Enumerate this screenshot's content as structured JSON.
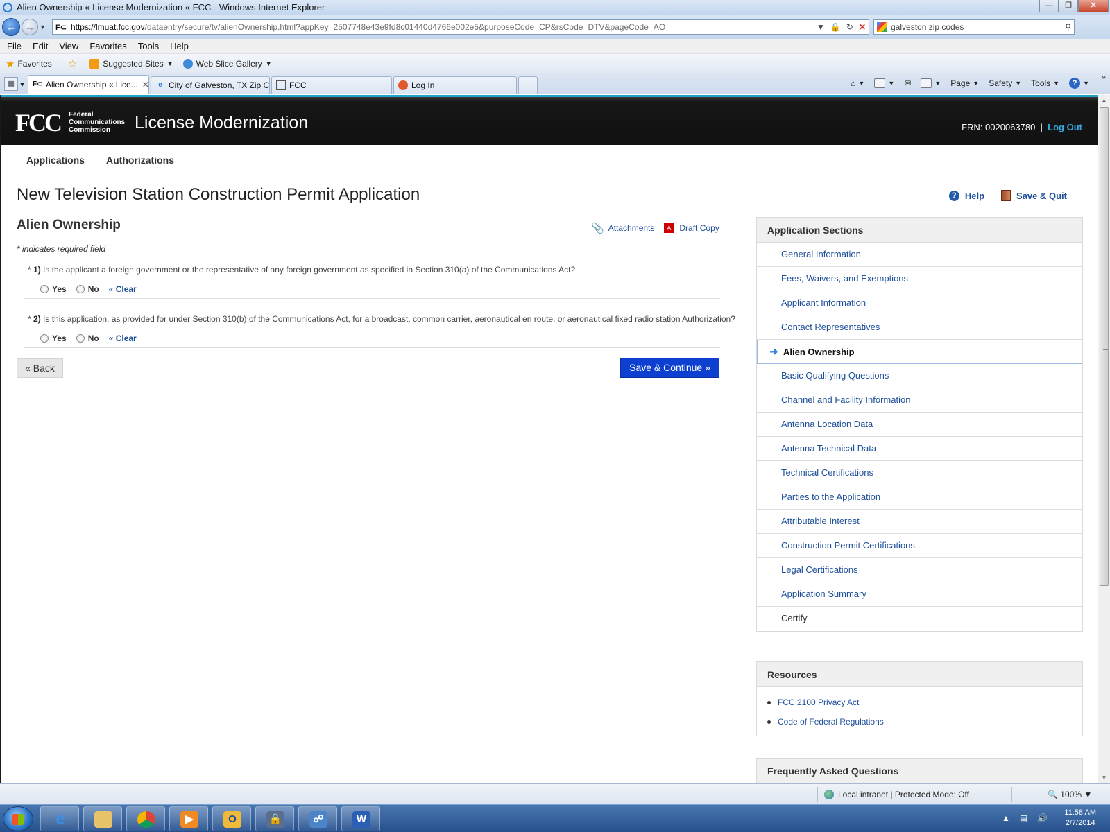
{
  "browser": {
    "window_title": "Alien Ownership « License Modernization « FCC - Windows Internet Explorer",
    "url_host": "https://lmuat.fcc.gov",
    "url_path": "/dataentry/secure/tv/alienOwnership.html?appKey=2507748e43e9fd8c01440d4766e002e5&purposeCode=CP&rsCode=DTV&pageCode=AO",
    "search_text": "galveston zip codes",
    "menu": [
      "File",
      "Edit",
      "View",
      "Favorites",
      "Tools",
      "Help"
    ],
    "favorites_label": "Favorites",
    "suggested_sites": "Suggested Sites",
    "web_slice_gallery": "Web Slice Gallery",
    "tabs": [
      {
        "label": "Alien Ownership « Lice...",
        "active": true
      },
      {
        "label": "City of Galveston, TX Zip C...",
        "active": false
      },
      {
        "label": "FCC",
        "active": false
      },
      {
        "label": "Log In",
        "active": false
      }
    ],
    "commands": {
      "page": "Page",
      "safety": "Safety",
      "tools": "Tools"
    },
    "status_zone": "Local intranet | Protected Mode: Off",
    "zoom": "100%"
  },
  "header": {
    "logo_mark": "FCC",
    "agency_line1": "Federal",
    "agency_line2": "Communications",
    "agency_line3": "Commission",
    "app_title": "License Modernization",
    "frn": "FRN: 0020063780",
    "separator": "|",
    "logout": "Log Out"
  },
  "topnav": {
    "applications": "Applications",
    "authorizations": "Authorizations"
  },
  "page": {
    "title": "New Television Station Construction Permit Application",
    "help": "Help",
    "save_quit": "Save & Quit",
    "section_title": "Alien Ownership",
    "attachments": "Attachments",
    "draft_copy": "Draft Copy",
    "required_note": "* indicates required field"
  },
  "questions": [
    {
      "prefix": "* ",
      "number": "1)",
      "text": " Is the applicant a foreign government or the representative of any foreign government as specified in Section 310(a) of the Communications Act?",
      "yes": "Yes",
      "no": "No",
      "clear": "« Clear"
    },
    {
      "prefix": "* ",
      "number": "2)",
      "text": " Is this application, as provided for under Section 310(b) of the Communications Act, for a broadcast, common carrier, aeronautical en route, or aeronautical fixed radio station Authorization?",
      "yes": "Yes",
      "no": "No",
      "clear": "« Clear"
    }
  ],
  "buttons": {
    "back": "« Back",
    "save_continue": "Save & Continue »"
  },
  "sidebar": {
    "sections_title": "Application Sections",
    "sections": [
      "General Information",
      "Fees, Waivers, and Exemptions",
      "Applicant Information",
      "Contact Representatives",
      "Alien Ownership",
      "Basic Qualifying Questions",
      "Channel and Facility Information",
      "Antenna Location Data",
      "Antenna Technical Data",
      "Technical Certifications",
      "Parties to the Application",
      "Attributable Interest",
      "Construction Permit Certifications",
      "Legal Certifications",
      "Application Summary",
      "Certify"
    ],
    "current_section": "Alien Ownership",
    "resources_title": "Resources",
    "resources": [
      "FCC 2100 Privacy Act",
      "Code of Federal Regulations"
    ],
    "faq_title": "Frequently Asked Questions"
  },
  "taskbar": {
    "time": "11:58 AM",
    "date": "2/7/2014"
  },
  "colors": {
    "accent_link": "#1d4f9a",
    "primary_button": "#0d3fd0",
    "header_bg": "#111111",
    "header_stripe": "#22a3c9"
  }
}
